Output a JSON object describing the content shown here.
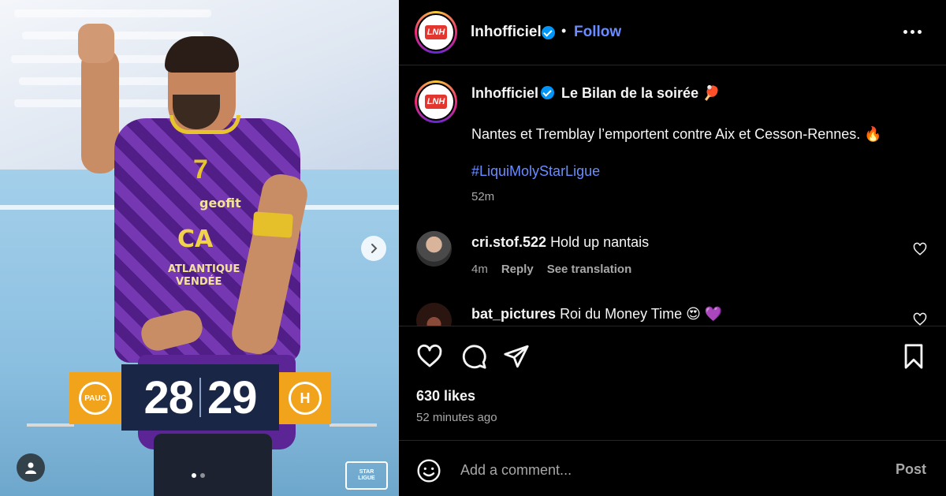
{
  "media": {
    "jersey_number": "7",
    "sponsor_main": "geofit",
    "sponsor_chest_1": "CA",
    "sponsor_chest_2": "ATLANTIQUE",
    "sponsor_chest_3": "VENDÉE",
    "score_home": "28",
    "score_away": "29",
    "home_logo_text": "PAUC",
    "away_logo_text": "H",
    "carousel_current": 1,
    "carousel_total": 2,
    "icons": {
      "next": "chevron-right-icon",
      "user_tag": "user-icon"
    }
  },
  "header": {
    "username": "lnhofficiel",
    "separator": "•",
    "follow_label": "Follow"
  },
  "caption": {
    "username": "lnhofficiel",
    "headline": "Le Bilan de la soirée",
    "headline_emoji": "🏓",
    "text": "Nantes et Tremblay l’emportent contre Aix et Cesson-Rennes.",
    "text_emoji": "🔥",
    "hashtag": "#LiquiMolyStarLigue",
    "time": "52m"
  },
  "comments": [
    {
      "username": "cri.stof.522",
      "text": "Hold up nantais",
      "time": "4m",
      "reply_label": "Reply",
      "translate_label": "See translation"
    },
    {
      "username": "bat_pictures",
      "text": "Roi du Money Time",
      "emojis": "😍 💜"
    }
  ],
  "actions": {
    "likes": "630 likes",
    "time": "52 minutes ago",
    "icons": [
      "heart-icon",
      "comment-icon",
      "share-icon",
      "bookmark-icon"
    ]
  },
  "comment_bar": {
    "placeholder": "Add a comment...",
    "post_label": "Post"
  },
  "colors": {
    "link": "#6a8cff",
    "verified": "#0095f6",
    "muted": "#a8a8a8",
    "score_bg": "#1a2645",
    "score_accent": "#f2a31c",
    "jersey": "#6a2aa8"
  }
}
